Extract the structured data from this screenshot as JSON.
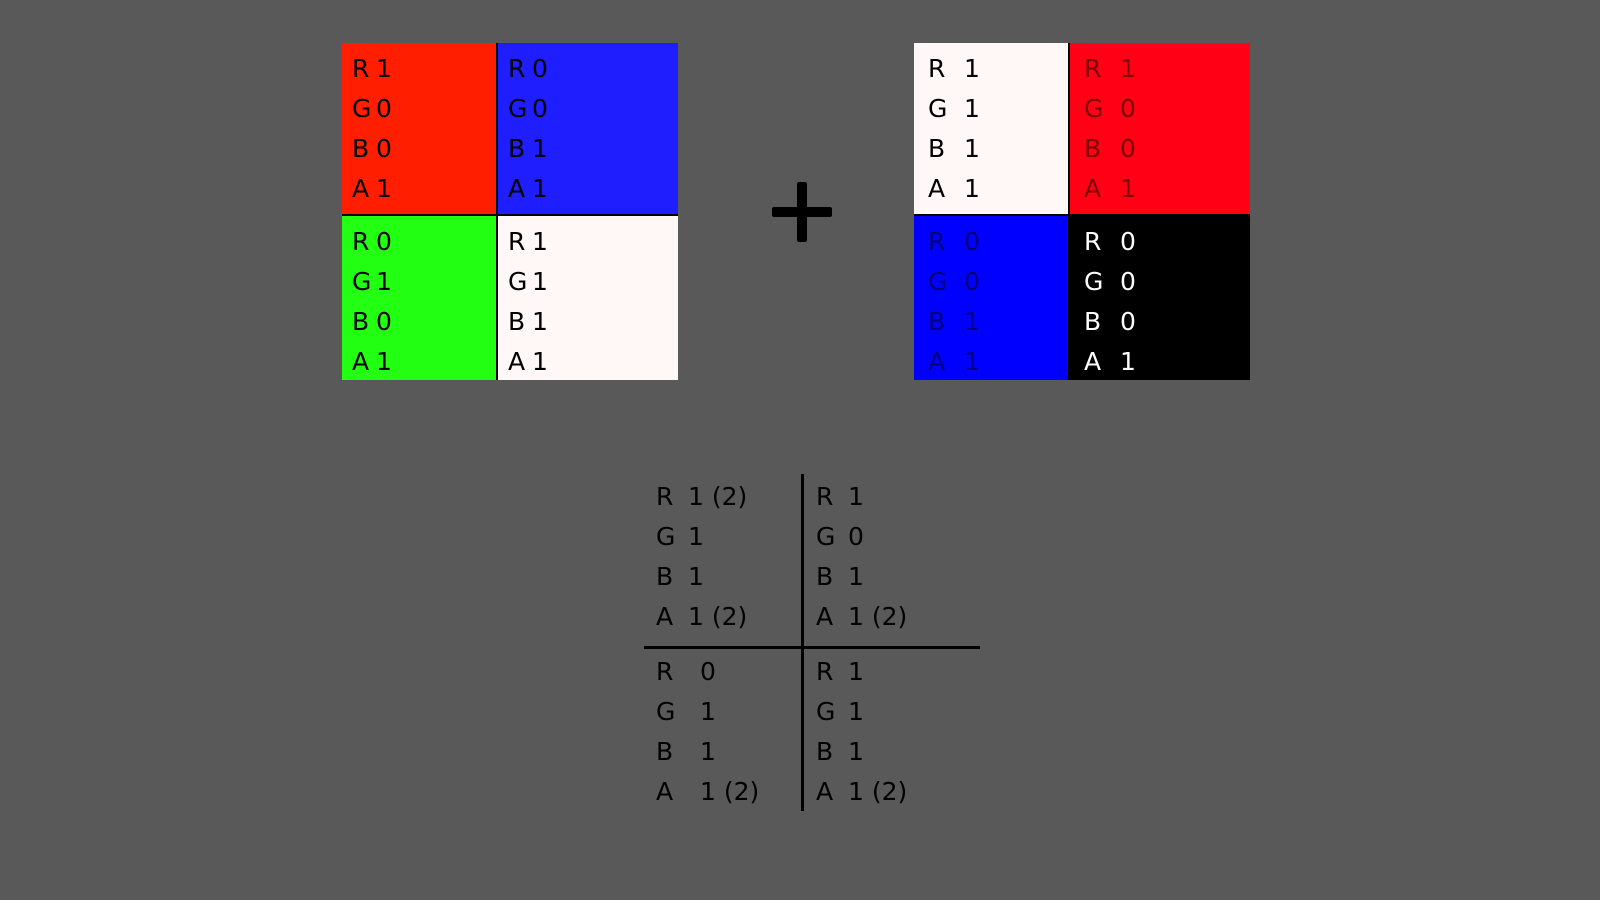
{
  "left_grid": {
    "cells": [
      {
        "color": "#ff1e00",
        "text_color": "#000000",
        "rows": [
          {
            "ch": "R",
            "val": "1"
          },
          {
            "ch": "G",
            "val": "0"
          },
          {
            "ch": "B",
            "val": "0"
          },
          {
            "ch": "A",
            "val": "1"
          }
        ]
      },
      {
        "color": "#1e1eff",
        "text_color": "#000000",
        "rows": [
          {
            "ch": "R",
            "val": "0"
          },
          {
            "ch": "G",
            "val": "0"
          },
          {
            "ch": "B",
            "val": "1"
          },
          {
            "ch": "A",
            "val": "1"
          }
        ]
      },
      {
        "color": "#22ff12",
        "text_color": "#000000",
        "rows": [
          {
            "ch": "R",
            "val": "0"
          },
          {
            "ch": "G",
            "val": "1"
          },
          {
            "ch": "B",
            "val": "0"
          },
          {
            "ch": "A",
            "val": "1"
          }
        ]
      },
      {
        "color": "#fff8f6",
        "text_color": "#000000",
        "rows": [
          {
            "ch": "R",
            "val": "1"
          },
          {
            "ch": "G",
            "val": "1"
          },
          {
            "ch": "B",
            "val": "1"
          },
          {
            "ch": "A",
            "val": "1"
          }
        ]
      }
    ]
  },
  "right_grid": {
    "cells": [
      {
        "color": "#fff8f6",
        "text_color": "#000000",
        "rows": [
          {
            "ch": "R",
            "val": "1"
          },
          {
            "ch": "G",
            "val": "1"
          },
          {
            "ch": "B",
            "val": "1"
          },
          {
            "ch": "A",
            "val": "1"
          }
        ]
      },
      {
        "color": "#ff0015",
        "text_color": "#7a0000",
        "rows": [
          {
            "ch": "R",
            "val": "1"
          },
          {
            "ch": "G",
            "val": "0"
          },
          {
            "ch": "B",
            "val": "0"
          },
          {
            "ch": "A",
            "val": "1"
          }
        ]
      },
      {
        "color": "#0000ff",
        "text_color": "#00007a",
        "rows": [
          {
            "ch": "R",
            "val": "0"
          },
          {
            "ch": "G",
            "val": "0"
          },
          {
            "ch": "B",
            "val": "1"
          },
          {
            "ch": "A",
            "val": "1"
          }
        ]
      },
      {
        "color": "#000000",
        "text_color": "#ffffff",
        "rows": [
          {
            "ch": "R",
            "val": "0"
          },
          {
            "ch": "G",
            "val": "0"
          },
          {
            "ch": "B",
            "val": "0"
          },
          {
            "ch": "A",
            "val": "1"
          }
        ]
      }
    ]
  },
  "result_grid": {
    "cells": [
      {
        "color": "#595959",
        "text_color": "#000000",
        "rows": [
          {
            "ch": "R",
            "val": "1 (2)"
          },
          {
            "ch": "G",
            "val": "1"
          },
          {
            "ch": "B",
            "val": "1"
          },
          {
            "ch": "A",
            "val": "1 (2)"
          }
        ]
      },
      {
        "color": "#595959",
        "text_color": "#000000",
        "rows": [
          {
            "ch": "R",
            "val": "1"
          },
          {
            "ch": "G",
            "val": "0"
          },
          {
            "ch": "B",
            "val": "1"
          },
          {
            "ch": "A",
            "val": "1 (2)"
          }
        ]
      },
      {
        "color": "#595959",
        "text_color": "#000000",
        "rows": [
          {
            "ch": "R",
            "val": "0"
          },
          {
            "ch": "G",
            "val": "1"
          },
          {
            "ch": "B",
            "val": "1"
          },
          {
            "ch": "A",
            "val": "1 (2)"
          }
        ]
      },
      {
        "color": "#595959",
        "text_color": "#000000",
        "rows": [
          {
            "ch": "R",
            "val": "1"
          },
          {
            "ch": "G",
            "val": "1"
          },
          {
            "ch": "B",
            "val": "1"
          },
          {
            "ch": "A",
            "val": "1 (2)"
          }
        ]
      }
    ]
  },
  "operator": {
    "icon": "plus-icon"
  }
}
